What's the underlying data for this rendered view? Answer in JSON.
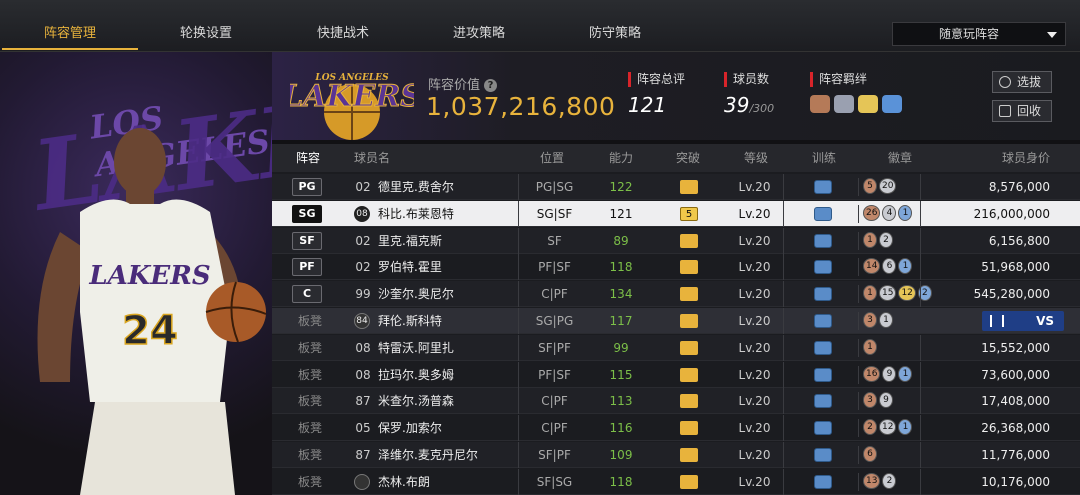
{
  "tabs": [
    {
      "label": "阵容管理",
      "active": true
    },
    {
      "label": "轮换设置",
      "active": false
    },
    {
      "label": "快捷战术",
      "active": false
    },
    {
      "label": "进攻策略",
      "active": false
    },
    {
      "label": "防守策略",
      "active": false
    }
  ],
  "dropdown": {
    "selected": "随意玩阵容"
  },
  "art": {
    "team_text": "LAKERS",
    "team_top": "LOS ANGELES",
    "jersey_team": "LAKERS",
    "jersey_number": "24"
  },
  "logo": {
    "top": "LOS ANGELES",
    "main": "LAKERS"
  },
  "summary": {
    "value_label": "阵容价值",
    "value": "1,037,216,800",
    "rating_label": "阵容总评",
    "rating": "121",
    "count_label": "球员数",
    "count": "39",
    "count_max": "/300",
    "bond_label": "阵容羁绊",
    "select_btn": "选拔",
    "recycle_btn": "回收"
  },
  "table": {
    "headers": {
      "lineup": "阵容",
      "name": "球员名",
      "position": "位置",
      "ability": "能力",
      "breakthrough": "突破",
      "level": "等级",
      "training": "训练",
      "badges": "徽章",
      "price": "球员身价"
    },
    "rows": [
      {
        "slot": "PG",
        "num": "02",
        "name": "德里克.费舍尔",
        "pos": "PG|SG",
        "ability": "122",
        "level": "Lv.20",
        "badges": [
          {
            "t": "5",
            "c": "b-bronze"
          },
          {
            "t": "20",
            "c": "b-silver"
          }
        ],
        "price": "8,576,000"
      },
      {
        "slot": "SG",
        "num": "08",
        "name": "科比.布莱恩特",
        "pos": "SG|SF",
        "ability": "121",
        "break": "5",
        "level": "Lv.20",
        "badges": [
          {
            "t": "26",
            "c": "b-bronze"
          },
          {
            "t": "4",
            "c": "b-silver"
          },
          {
            "t": "1",
            "c": "b-blue"
          }
        ],
        "price": "216,000,000"
      },
      {
        "slot": "SF",
        "num": "02",
        "name": "里克.福克斯",
        "pos": "SF",
        "ability": "89",
        "level": "Lv.20",
        "badges": [
          {
            "t": "1",
            "c": "b-bronze"
          },
          {
            "t": "2",
            "c": "b-silver"
          }
        ],
        "price": "6,156,800"
      },
      {
        "slot": "PF",
        "num": "02",
        "name": "罗伯特.霍里",
        "pos": "PF|SF",
        "ability": "118",
        "level": "Lv.20",
        "badges": [
          {
            "t": "14",
            "c": "b-bronze"
          },
          {
            "t": "6",
            "c": "b-silver"
          },
          {
            "t": "1",
            "c": "b-blue"
          }
        ],
        "price": "51,968,000"
      },
      {
        "slot": "C",
        "num": "99",
        "name": "沙奎尔.奥尼尔",
        "pos": "C|PF",
        "ability": "134",
        "level": "Lv.20",
        "badges": [
          {
            "t": "1",
            "c": "b-bronze"
          },
          {
            "t": "15",
            "c": "b-silver"
          },
          {
            "t": "12",
            "c": "b-gold"
          },
          {
            "t": "2",
            "c": "b-blue"
          }
        ],
        "price": "545,280,000"
      },
      {
        "slot": "板凳",
        "num": "84",
        "name": "拜伦.斯科特",
        "pos": "SG|PG",
        "ability": "117",
        "level": "Lv.20",
        "badges": [
          {
            "t": "3",
            "c": "b-bronze"
          },
          {
            "t": "1",
            "c": "b-silver"
          }
        ],
        "price": "",
        "vs": "VS"
      },
      {
        "slot": "板凳",
        "num": "08",
        "name": "特雷沃.阿里扎",
        "pos": "SF|PF",
        "ability": "99",
        "level": "Lv.20",
        "badges": [
          {
            "t": "1",
            "c": "b-bronze"
          }
        ],
        "price": "15,552,000"
      },
      {
        "slot": "板凳",
        "num": "08",
        "name": "拉玛尔.奥多姆",
        "pos": "PF|SF",
        "ability": "115",
        "level": "Lv.20",
        "badges": [
          {
            "t": "16",
            "c": "b-bronze"
          },
          {
            "t": "9",
            "c": "b-silver"
          },
          {
            "t": "1",
            "c": "b-blue"
          }
        ],
        "price": "73,600,000"
      },
      {
        "slot": "板凳",
        "num": "87",
        "name": "米查尔.汤普森",
        "pos": "C|PF",
        "ability": "113",
        "level": "Lv.20",
        "badges": [
          {
            "t": "3",
            "c": "b-bronze"
          },
          {
            "t": "9",
            "c": "b-silver"
          }
        ],
        "price": "17,408,000"
      },
      {
        "slot": "板凳",
        "num": "05",
        "name": "保罗.加索尔",
        "pos": "C|PF",
        "ability": "116",
        "level": "Lv.20",
        "badges": [
          {
            "t": "2",
            "c": "b-bronze"
          },
          {
            "t": "12",
            "c": "b-silver"
          },
          {
            "t": "1",
            "c": "b-blue"
          }
        ],
        "price": "26,368,000"
      },
      {
        "slot": "板凳",
        "num": "87",
        "name": "泽维尔.麦克丹尼尔",
        "pos": "SF|PF",
        "ability": "109",
        "level": "Lv.20",
        "badges": [
          {
            "t": "6",
            "c": "b-bronze"
          }
        ],
        "price": "11,776,000"
      },
      {
        "slot": "板凳",
        "num": "",
        "name": "杰林.布朗",
        "pos": "SF|SG",
        "ability": "118",
        "level": "Lv.20",
        "badges": [
          {
            "t": "13",
            "c": "b-bronze"
          },
          {
            "t": "2",
            "c": "b-silver"
          }
        ],
        "price": "10,176,000"
      }
    ]
  },
  "colors": {
    "accent": "#e8b33c",
    "ability": "#7cbf48",
    "bond_red": "#d8242a",
    "vs_blue": "#1f3e86"
  }
}
